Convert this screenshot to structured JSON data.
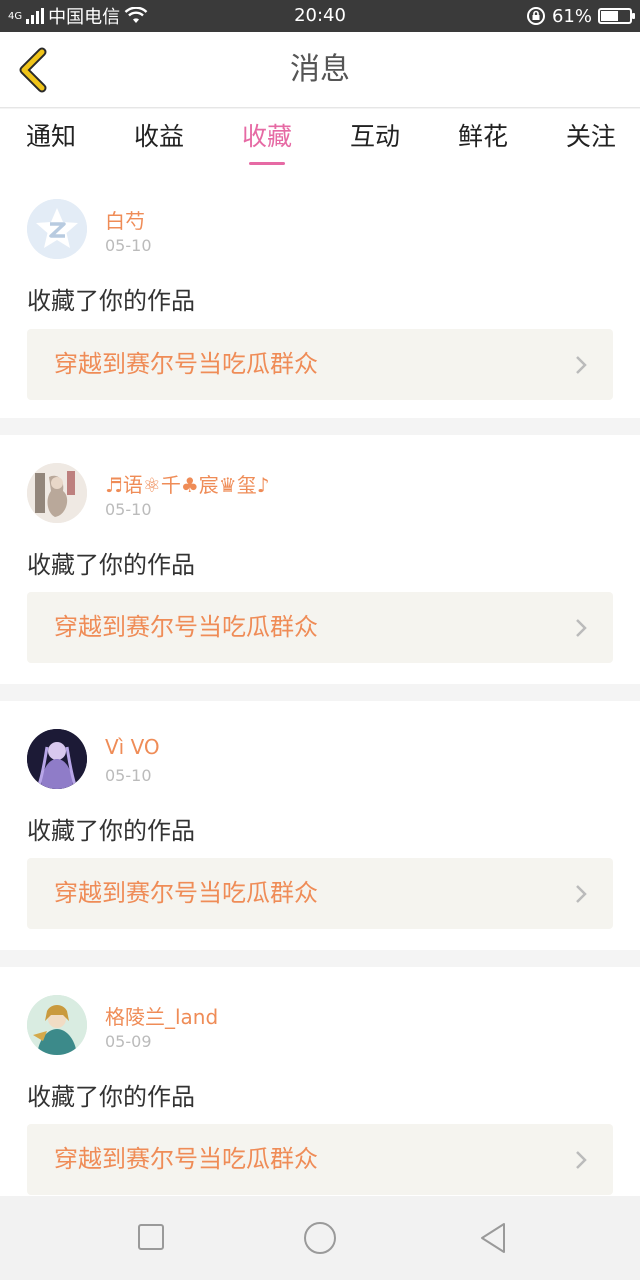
{
  "status_bar": {
    "network": "4G",
    "carrier": "中国电信",
    "time": "20:40",
    "battery_percent": "61%",
    "battery_level": 0.61
  },
  "header": {
    "title": "消息"
  },
  "tabs": [
    {
      "label": "通知",
      "active": false
    },
    {
      "label": "收益",
      "active": false
    },
    {
      "label": "收藏",
      "active": true
    },
    {
      "label": "互动",
      "active": false
    },
    {
      "label": "鲜花",
      "active": false
    },
    {
      "label": "关注",
      "active": false
    }
  ],
  "messages": [
    {
      "username": "白芍",
      "date": "05-10",
      "action": "收藏了你的作品",
      "work": "穿越到赛尔号当吃瓜群众"
    },
    {
      "username": "♬语⚛千♣宸♛玺♪",
      "date": "05-10",
      "action": "收藏了你的作品",
      "work": "穿越到赛尔号当吃瓜群众"
    },
    {
      "username": "Vì VO",
      "date": "05-10",
      "action": "收藏了你的作品",
      "work": "穿越到赛尔号当吃瓜群众"
    },
    {
      "username": "格陵兰_land",
      "date": "05-09",
      "action": "收藏了你的作品",
      "work": "穿越到赛尔号当吃瓜群众"
    }
  ],
  "colors": {
    "accent": "#e66aa4",
    "username": "#ef8c57",
    "back_arrow": "#f0c419"
  }
}
